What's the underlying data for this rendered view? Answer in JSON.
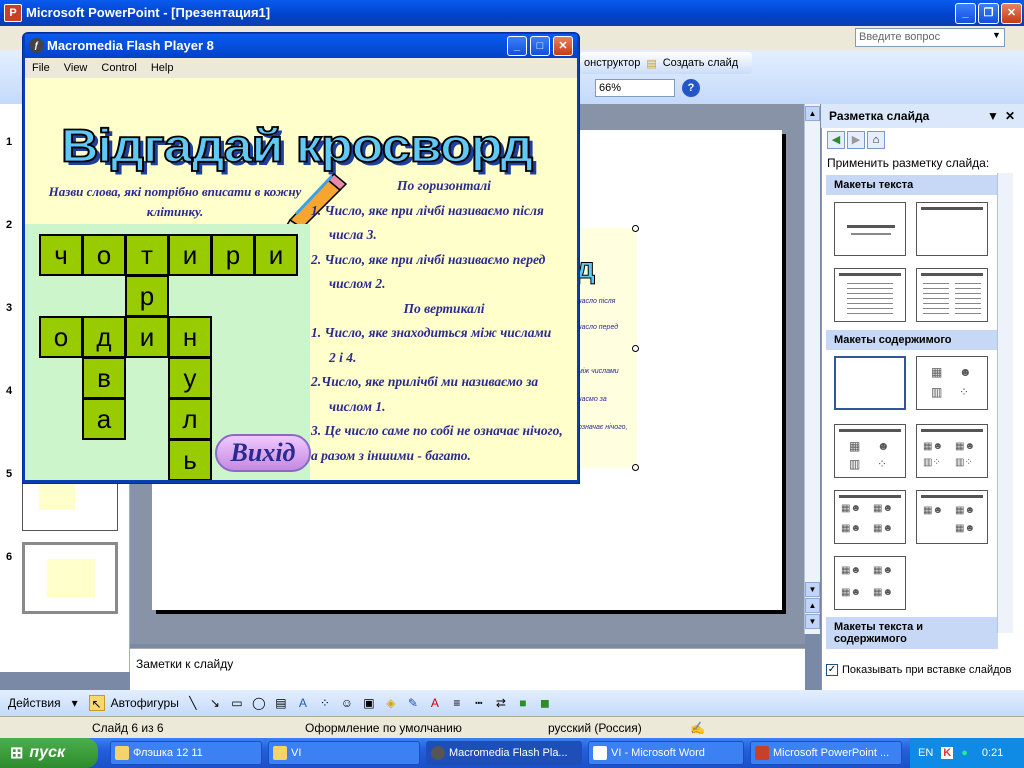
{
  "powerpoint": {
    "title": "Microsoft PowerPoint - [Презентация1]",
    "ask_placeholder": "Введите вопрос",
    "toolbar": {
      "designer": "онструктор",
      "new_slide": "Создать слайд",
      "zoom": "66%"
    },
    "slide_numbers": [
      "1",
      "2",
      "3",
      "4",
      "5",
      "6"
    ],
    "notes_placeholder": "Заметки к слайду"
  },
  "task_pane": {
    "title": "Разметка слайда",
    "apply_label": "Применить разметку слайда:",
    "sections": [
      "Макеты текста",
      "Макеты содержимого",
      "Макеты текста и содержимого"
    ],
    "show_on_insert": "Показывать при вставке слайдов"
  },
  "draw_toolbar": {
    "actions": "Действия",
    "autoshapes": "Автофигуры"
  },
  "status": {
    "slide": "Слайд 6 из 6",
    "design": "Оформление по умолчанию",
    "language": "русский (Россия)"
  },
  "taskbar": {
    "start": "пуск",
    "tasks": [
      "Флэшка 12 11",
      "VI",
      "Macromedia Flash Pla...",
      "VI - Microsoft Word",
      "Microsoft PowerPoint ..."
    ],
    "lang": "EN",
    "time": "0:21"
  },
  "flash": {
    "title": "Macromedia Flash Player 8",
    "menu": [
      "File",
      "View",
      "Control",
      "Help"
    ],
    "banner": "Відгадай кросворд",
    "hint": "Назви слова, які потрібно вписати в кожну клітинку.",
    "clues": {
      "horizontal_title": "По горизонталі",
      "h1": "1. Число, яке при  лічбі називаємо після",
      "h1b": "числа 3.",
      "h2": "2. Число, яке при лічбі називаємо перед",
      "h2b": "числом 2.",
      "vertical_title": "По вертикалі",
      "v1": "1. Число, яке знаходиться між числами",
      "v1b": "2 і 4.",
      "v2": "2.Число, яке прилічбі ми називаємо за",
      "v2b": "числом 1.",
      "v3": "3. Це число саме по собі не означає нічого,",
      "v3b": "а  разом з іншими - багато."
    },
    "crossword": {
      "row1": [
        "ч",
        "о",
        "т",
        "и",
        "р",
        "и"
      ],
      "r": "р",
      "row3": [
        "о",
        "д",
        "и",
        "н"
      ],
      "d_col": [
        "в",
        "а"
      ],
      "n_col": [
        "у",
        "л",
        "ь"
      ]
    },
    "exit_button": "Вихід"
  },
  "behind_slide_snippets": [
    "д",
    "часло після",
    "часло перед",
    "між числами",
    "часмо за",
    "означає нічого,"
  ]
}
